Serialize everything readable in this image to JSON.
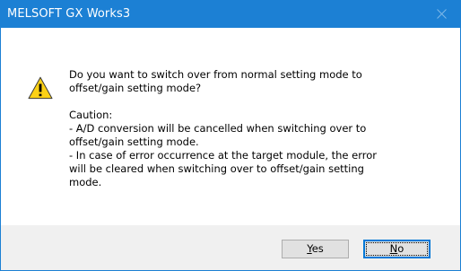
{
  "window": {
    "title": "MELSOFT GX Works3",
    "close_icon": "close-icon",
    "titlebar_color": "#1c80d4"
  },
  "dialog": {
    "icon": "warning-icon",
    "question_lines": [
      "Do you want to switch over from normal setting mode to",
      "offset/gain setting mode?"
    ],
    "caution_lines": [
      "Caution:",
      "- A/D conversion will be cancelled when switching over to",
      "offset/gain setting mode.",
      "- In case of error occurrence at the target module, the error",
      "will be cleared when switching over to offset/gain setting",
      "mode."
    ]
  },
  "buttons": {
    "yes": {
      "accel": "Y",
      "rest": "es"
    },
    "no": {
      "accel": "N",
      "rest": "o"
    }
  }
}
